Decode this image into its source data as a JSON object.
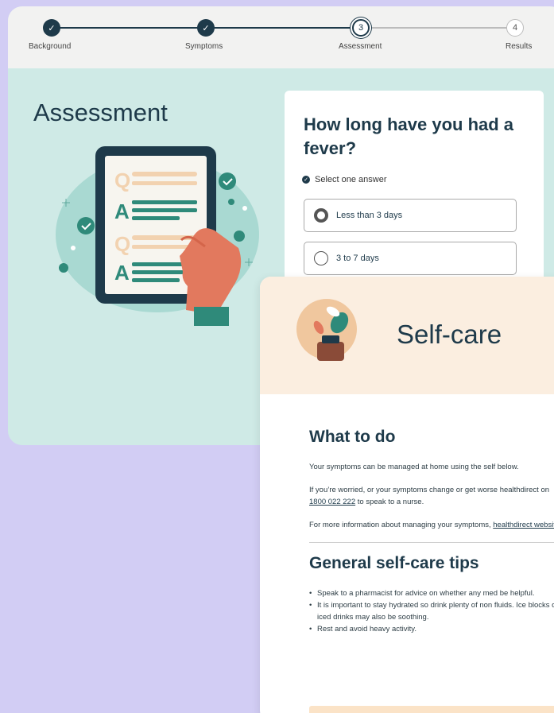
{
  "stepper": {
    "steps": [
      {
        "label": "Background",
        "state": "done"
      },
      {
        "label": "Symptoms",
        "state": "done"
      },
      {
        "label": "Assessment",
        "state": "current",
        "number": "3"
      },
      {
        "label": "Results",
        "state": "future",
        "number": "4"
      }
    ],
    "check_glyph": "✓"
  },
  "assessment": {
    "title": "Assessment",
    "illustration": {
      "icon": "tablet-qa-icon",
      "q_letter": "Q",
      "a_letter": "A"
    }
  },
  "question": {
    "title": "How long have you had a fever?",
    "hint": "Select one answer",
    "options": [
      {
        "label": "Less than 3 days",
        "selected": true
      },
      {
        "label": "3 to 7 days",
        "selected": false
      }
    ]
  },
  "selfcare": {
    "title": "Self-care",
    "what_to_do_heading": "What to do",
    "para1": "Your symptoms can be managed at home using the self below.",
    "para2_prefix": "If you’re worried, or your symptoms change or get worse healthdirect on ",
    "para2_link": "1800 022 222",
    "para2_suffix": " to speak to a nurse.",
    "para3_prefix": "For more information about managing your symptoms, ",
    "para3_link": "healthdirect website",
    "para3_suffix": ".",
    "tips_heading": "General self-care tips",
    "tips": [
      "Speak to a pharmacist for advice on whether any med be helpful.",
      "It is important to stay hydrated so drink plenty of non fluids. Ice blocks or iced drinks may also be soothing.",
      "Rest and avoid heavy activity."
    ]
  },
  "colors": {
    "background": "#d2cdf4",
    "assessment_panel": "#cfeae6",
    "primary": "#1e3a4a",
    "selfcare_header": "#fbeee0",
    "accent_teal": "#2f8a7a"
  }
}
